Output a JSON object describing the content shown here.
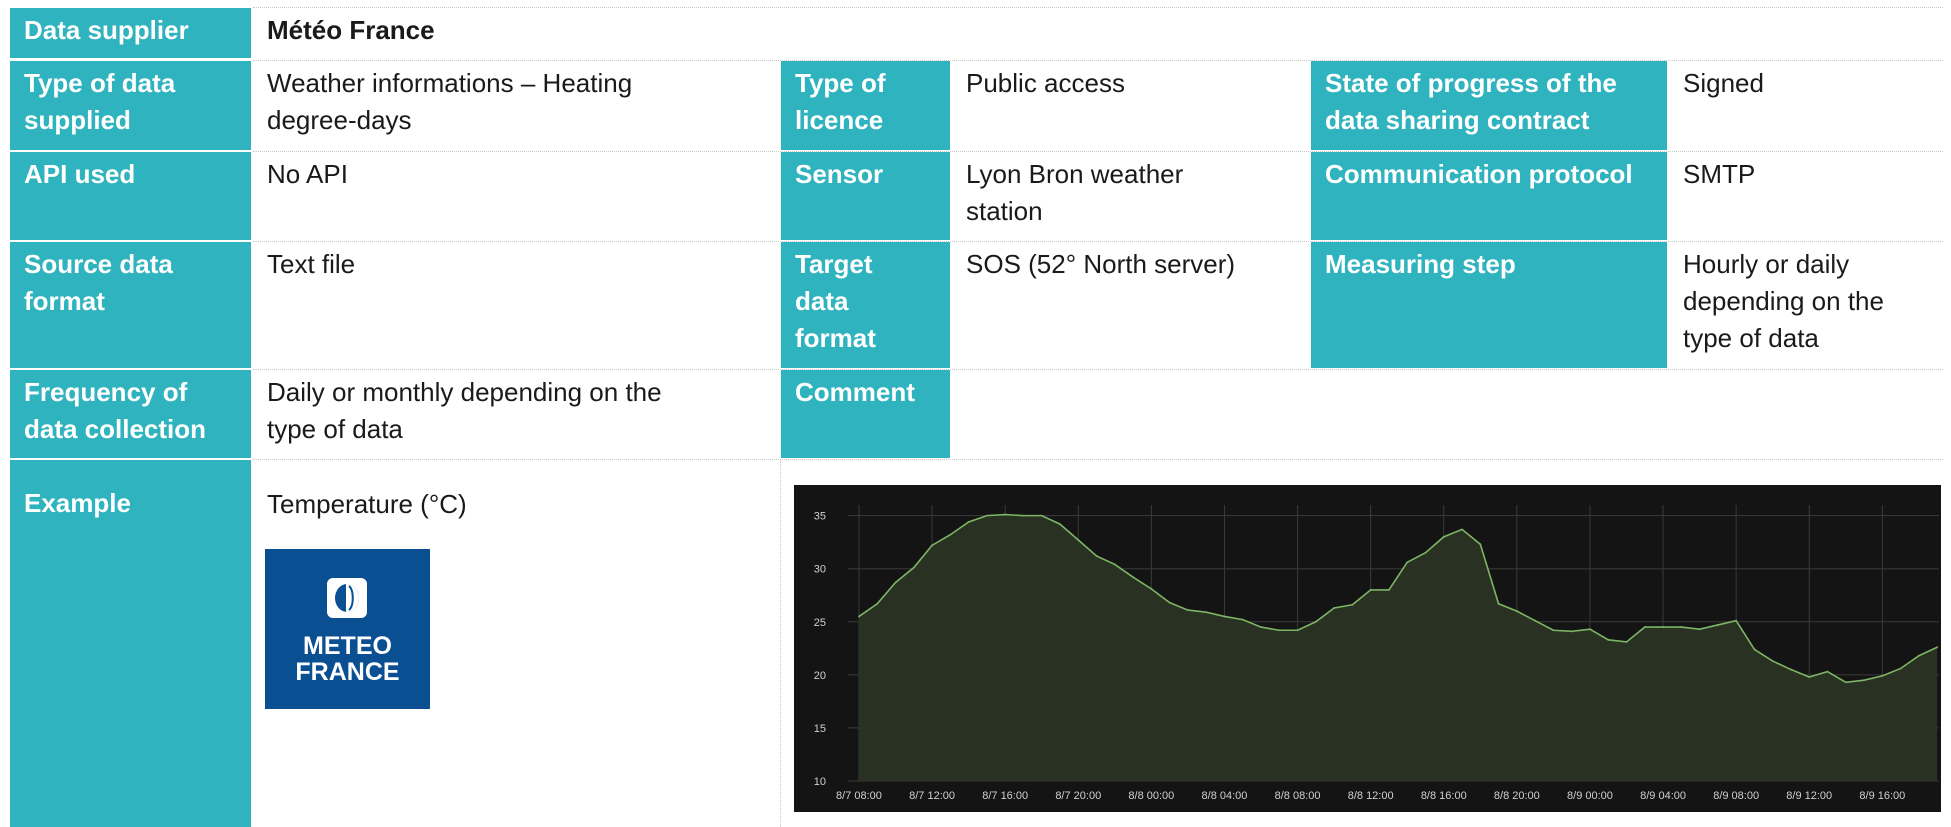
{
  "table": {
    "data_supplier_label": "Data supplier",
    "data_supplier_value": "Météo France",
    "type_of_data_label": "Type of data\nsupplied",
    "type_of_data_value": "Weather informations – Heating\ndegree-days",
    "type_of_licence_label": "Type of\nlicence",
    "type_of_licence_value": "Public access",
    "contract_state_label": "State of progress of the\ndata sharing contract",
    "contract_state_value": "Signed",
    "api_label": "API used",
    "api_value": "No API",
    "sensor_label": "Sensor",
    "sensor_value": "Lyon Bron weather\nstation",
    "protocol_label": "Communication protocol",
    "protocol_value": "SMTP",
    "source_format_label": "Source data\nformat",
    "source_format_value": "Text file",
    "target_format_label": "Target\ndata\nformat",
    "target_format_value": "SOS (52° North server)",
    "measuring_step_label": "Measuring step",
    "measuring_step_value": "Hourly or daily\ndepending on the\ntype of data",
    "frequency_label": "Frequency of\ndata collection",
    "frequency_value": "Daily or monthly depending on the\ntype of data",
    "comment_label": "Comment",
    "comment_value": "",
    "example_label": "Example",
    "example_caption": "Temperature (°C)"
  },
  "logo": {
    "line1": "METEO",
    "line2": "FRANCE",
    "background": "#0b4f93"
  },
  "colors": {
    "header": "#2fb3bf",
    "chart_background": "#141414",
    "series_line": "#7db564"
  },
  "chart_data": {
    "type": "area",
    "title": "",
    "xlabel": "",
    "ylabel": "",
    "ylim": [
      10,
      36
    ],
    "yticks": [
      10,
      15,
      20,
      25,
      30,
      35
    ],
    "x_tick_labels": [
      "8/7 08:00",
      "8/7 12:00",
      "8/7 16:00",
      "8/7 20:00",
      "8/8 00:00",
      "8/8 04:00",
      "8/8 08:00",
      "8/8 12:00",
      "8/8 16:00",
      "8/8 20:00",
      "8/9 00:00",
      "8/9 04:00",
      "8/9 08:00",
      "8/9 12:00",
      "8/9 16:00"
    ],
    "x_hours": [
      0,
      1,
      2,
      3,
      4,
      5,
      6,
      7,
      8,
      9,
      10,
      11,
      12,
      13,
      14,
      15,
      16,
      17,
      18,
      19,
      20,
      21,
      22,
      23,
      24,
      25,
      26,
      27,
      28,
      29,
      30,
      31,
      32,
      33,
      34,
      35,
      36,
      37,
      38,
      39,
      40,
      41,
      42,
      43,
      44,
      45,
      46,
      47,
      48,
      49,
      50,
      51,
      52,
      53,
      54,
      55,
      56,
      57,
      58,
      59
    ],
    "series": [
      {
        "values": [
          25.5,
          26.7,
          28.7,
          30.1,
          32.2,
          33.2,
          34.4,
          35.0,
          35.1,
          35.0,
          35.0,
          34.2,
          32.7,
          31.2,
          30.4,
          29.2,
          28.1,
          26.8,
          26.1,
          25.9,
          25.5,
          25.2,
          24.5,
          24.2,
          24.2,
          25.0,
          26.3,
          26.6,
          28.0,
          28.0,
          30.6,
          31.5,
          33.0,
          33.7,
          32.3,
          26.7,
          26.0,
          25.1,
          24.2,
          24.1,
          24.3,
          23.3,
          23.1,
          24.5,
          24.5,
          24.5,
          24.3,
          24.7,
          25.1,
          22.4,
          21.3,
          20.5,
          19.8,
          20.3,
          19.3,
          19.5,
          19.9,
          20.6,
          21.8,
          22.6
        ]
      }
    ]
  }
}
